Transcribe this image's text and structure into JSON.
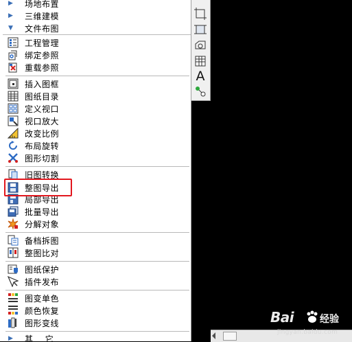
{
  "menu": {
    "tree": [
      {
        "label": "场地布置",
        "arrow": "▶"
      },
      {
        "label": "三维建模",
        "arrow": "▶"
      },
      {
        "label": "文件布图",
        "arrow": "▼"
      }
    ],
    "items": [
      {
        "label": "工程管理",
        "icon": "project-manager-icon"
      },
      {
        "label": "绑定参照",
        "icon": "bind-xref-icon"
      },
      {
        "label": "重载参照",
        "icon": "reload-xref-icon"
      },
      {
        "label": "插入图框",
        "icon": "insert-frame-icon"
      },
      {
        "label": "图纸目录",
        "icon": "drawing-catalog-icon"
      },
      {
        "label": "定义视口",
        "icon": "define-viewport-icon"
      },
      {
        "label": "视口放大",
        "icon": "viewport-zoom-icon"
      },
      {
        "label": "改变比例",
        "icon": "change-scale-icon"
      },
      {
        "label": "布局旋转",
        "icon": "layout-rotate-icon"
      },
      {
        "label": "图形切割",
        "icon": "graphic-cut-icon"
      },
      {
        "label": "旧图转换",
        "icon": "old-drawing-convert-icon"
      },
      {
        "label": "整图导出",
        "icon": "export-drawing-icon"
      },
      {
        "label": "局部导出",
        "icon": "partial-export-icon"
      },
      {
        "label": "批量导出",
        "icon": "batch-export-icon"
      },
      {
        "label": "分解对象",
        "icon": "explode-object-icon"
      },
      {
        "label": "备档拆图",
        "icon": "archive-split-icon"
      },
      {
        "label": "整图比对",
        "icon": "drawing-compare-icon"
      },
      {
        "label": "图纸保护",
        "icon": "drawing-protect-icon"
      },
      {
        "label": "插件发布",
        "icon": "plugin-publish-icon"
      },
      {
        "label": "图变单色",
        "icon": "monochrome-icon"
      },
      {
        "label": "颜色恢复",
        "icon": "color-restore-icon"
      },
      {
        "label": "图形变线",
        "icon": "graphic-to-line-icon"
      }
    ],
    "bottom_item": {
      "label": "其    它",
      "arrow": "▶"
    },
    "highlighted": "整图导出",
    "highlight_color": "#e2161d"
  },
  "toolbar": {
    "icons": [
      "frame-corner-icon",
      "frame-select-icon",
      "shape-outline-icon",
      "table-icon",
      "text-icon",
      "connect-nodes-icon"
    ],
    "text_glyph": "A"
  },
  "watermark": {
    "brand": "Bai",
    "brand2": "经验",
    "url": "jingyan.baidu.com"
  },
  "colors": {
    "canvas": "#000000",
    "panel": "#ffffff",
    "accent_blue": "#3b6fb6"
  }
}
